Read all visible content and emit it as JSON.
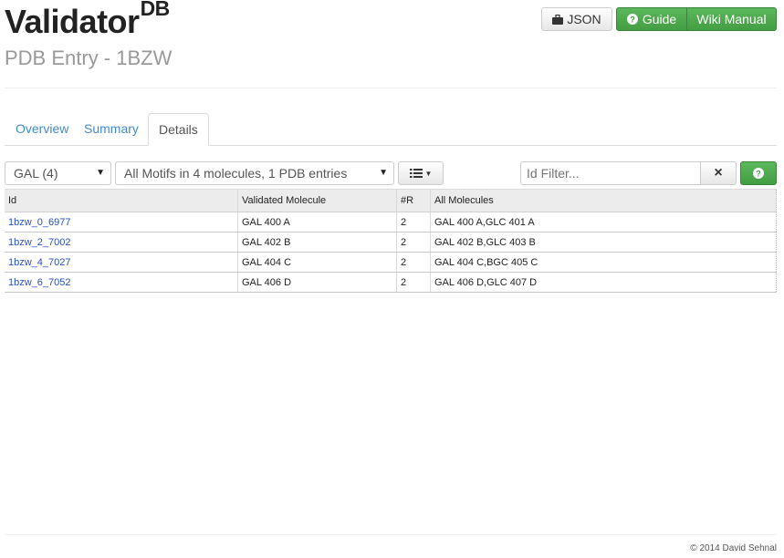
{
  "header": {
    "brand": "Validator",
    "brand_sup": "DB",
    "subtitle": "PDB Entry - 1BZW"
  },
  "toolbar": {
    "json_label": "JSON",
    "guide_label": "Guide",
    "wiki_label": "Wiki Manual"
  },
  "tabs": [
    {
      "label": "Overview",
      "active": false
    },
    {
      "label": "Summary",
      "active": false
    },
    {
      "label": "Details",
      "active": true
    }
  ],
  "filters": {
    "residue_select": "GAL (4)",
    "motif_select": "All Motifs in 4 molecules, 1 PDB entries",
    "id_filter_placeholder": "Id Filter...",
    "clear_icon": "×",
    "help_icon": "?"
  },
  "table": {
    "columns": [
      "Id",
      "Validated Molecule",
      "#R",
      "All Molecules"
    ],
    "rows": [
      [
        "1bzw_0_6977",
        "GAL 400 A",
        "2",
        "GAL 400 A,GLC 401 A"
      ],
      [
        "1bzw_2_7002",
        "GAL 402 B",
        "2",
        "GAL 402 B,GLC 403 B"
      ],
      [
        "1bzw_4_7027",
        "GAL 404 C",
        "2",
        "GAL 404 C,BGC 405 C"
      ],
      [
        "1bzw_6_7052",
        "GAL 406 D",
        "2",
        "GAL 406 D,GLC 407 D"
      ]
    ]
  },
  "footer": {
    "copyright": "© 2014 David Sehnal"
  },
  "colors": {
    "link": "#428bca",
    "accent_green": "#5cb85c",
    "table_link": "#2a4fc0"
  }
}
